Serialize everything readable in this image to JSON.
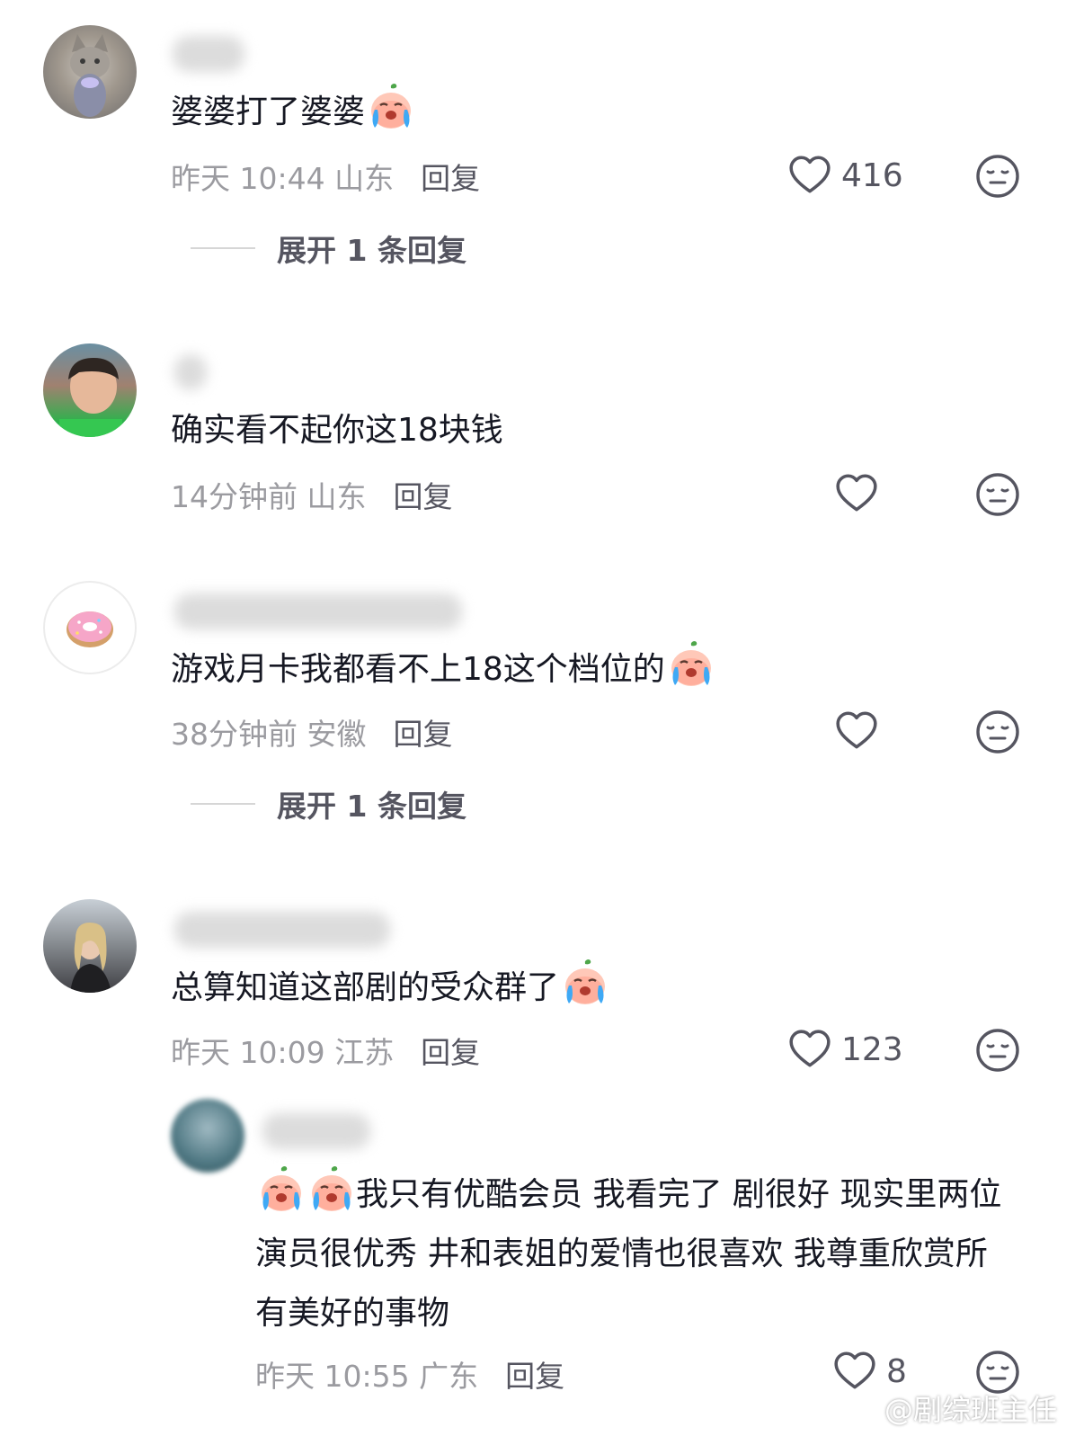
{
  "comments": [
    {
      "text": "婆婆打了婆婆",
      "emoji": "crying-face-emoji",
      "time": "昨天 10:44 山东",
      "reply_label": "回复",
      "likes": "416",
      "expand_label": "展开 1 条回复"
    },
    {
      "text": "确实看不起你这18块钱",
      "time": "14分钟前 山东",
      "reply_label": "回复",
      "likes": ""
    },
    {
      "text": "游戏月卡我都看不上18这个档位的",
      "emoji": "crying-face-emoji",
      "time": "38分钟前 安徽",
      "reply_label": "回复",
      "likes": "",
      "expand_label": "展开 1 条回复"
    },
    {
      "text": "总算知道这部剧的受众群了",
      "emoji": "crying-face-emoji",
      "time": "昨天 10:09 江苏",
      "reply_label": "回复",
      "likes": "123"
    }
  ],
  "reply": {
    "text": "我只有优酷会员 我看完了 剧很好 现实里两位演员很优秀 井和表姐的爱情也很喜欢 我尊重欣赏所有美好的事物",
    "emoji": "crying-face-emoji",
    "time": "昨天 10:55 广东",
    "reply_label": "回复",
    "likes": "8"
  },
  "watermark": "@剧综班主任",
  "colors": {
    "text": "#161823",
    "meta": "#9b9ba0",
    "action": "#555560",
    "background": "#ffffff"
  }
}
